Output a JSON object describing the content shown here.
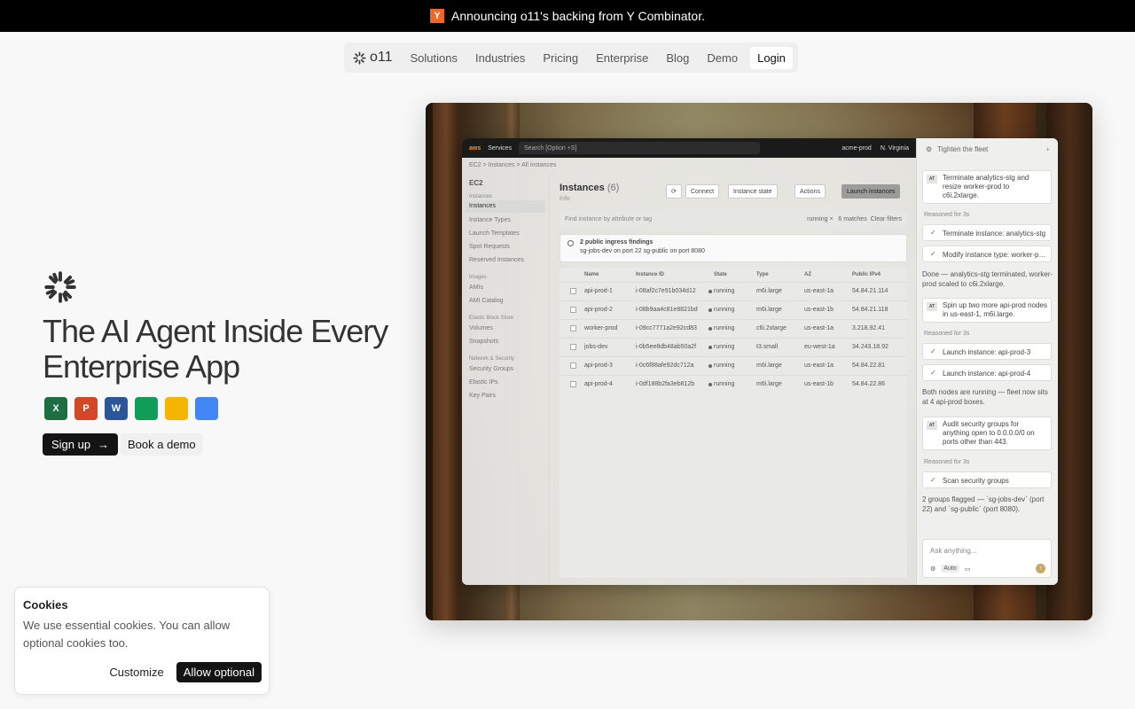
{
  "announcement": {
    "badge": "Y",
    "text": "Announcing o11's backing from Y Combinator."
  },
  "nav": {
    "logo": "o11",
    "links": [
      "Solutions",
      "Industries",
      "Pricing",
      "Enterprise",
      "Blog",
      "Demo"
    ],
    "login": "Login"
  },
  "hero": {
    "title": "The AI Agent Inside Every Enterprise App",
    "apps": [
      {
        "name": "excel-icon",
        "letter": "X",
        "color": "#1d6f42"
      },
      {
        "name": "powerpoint-icon",
        "letter": "P",
        "color": "#d24726"
      },
      {
        "name": "word-icon",
        "letter": "W",
        "color": "#2b579a"
      },
      {
        "name": "google-sheets-icon",
        "letter": "",
        "color": "#0f9d58"
      },
      {
        "name": "google-slides-icon",
        "letter": "",
        "color": "#f4b400"
      },
      {
        "name": "google-docs-icon",
        "letter": "",
        "color": "#4285f4"
      }
    ],
    "signup": "Sign up",
    "signup_arrow": "→",
    "book_demo": "Book a demo"
  },
  "cookies": {
    "title": "Cookies",
    "body": "We use essential cookies. You can allow optional cookies too.",
    "customize": "Customize",
    "allow": "Allow optional"
  },
  "console": {
    "topbar": {
      "logo": "aws",
      "services": "Services",
      "search": "Search [Option +S]",
      "account": "acme-prod",
      "region": "N. Virginia"
    },
    "breadcrumb": "EC2  >  Instances  >  All instances",
    "sidebar": {
      "title": "EC2",
      "sections": [
        {
          "label": "Instances",
          "items": [
            "Instances",
            "Instance Types",
            "Launch Templates",
            "Spot Requests",
            "Reserved Instances"
          ]
        },
        {
          "label": "Images",
          "items": [
            "AMIs",
            "AMI Catalog"
          ]
        },
        {
          "label": "Elastic Block Store",
          "items": [
            "Volumes",
            "Snapshots"
          ]
        },
        {
          "label": "Network & Security",
          "items": [
            "Security Groups",
            "Elastic IPs",
            "Key Pairs"
          ]
        }
      ]
    },
    "main": {
      "title": "Instances",
      "count": "(6)",
      "info": "Info",
      "buttons": {
        "refresh": "⟳",
        "connect": "Connect",
        "state": "Instance state",
        "actions": "Actions",
        "launch": "Launch instances"
      },
      "filter_placeholder": "Find instance by attribute or tag",
      "filter_tag": "running ×",
      "filter_matches": "6 matches",
      "clear": "Clear filters",
      "alert_title": "2 public ingress findings",
      "alert_body": "sg-jobs-dev on port 22    sg-public on port 8080",
      "columns": [
        "Name",
        "Instance ID",
        "State",
        "Type",
        "AZ",
        "Public IPv4"
      ],
      "rows": [
        [
          "api-prod-1",
          "i-08af2c7e91b034d12",
          "running",
          "m6i.large",
          "us-east-1a",
          "54.84.21.114"
        ],
        [
          "api-prod-2",
          "i-08b9aa4c81e8821bd",
          "running",
          "m6i.large",
          "us-east-1b",
          "54.84.21.118"
        ],
        [
          "worker-prod",
          "i-09cc7771a2e92cd83",
          "running",
          "c6i.2xlarge",
          "us-east-1a",
          "3.218.92.41"
        ],
        [
          "jobs-dev",
          "i-0b5ee8db48ab50a2f",
          "running",
          "t3.small",
          "eu-west-1a",
          "34.243.18.92"
        ],
        [
          "api-prod-3",
          "i-0c6f88afe92dc712a",
          "running",
          "m6i.large",
          "us-east-1a",
          "54.84.22.81"
        ],
        [
          "api-prod-4",
          "i-0df188b2fa3eb812b",
          "running",
          "m6i.large",
          "us-east-1b",
          "54.84.22.86"
        ]
      ]
    },
    "chat": {
      "title": "Tighten the fleet",
      "avatar": "AT",
      "user_1": "Terminate analytics-stg and resize worker-prod to c6i.2xlarge.",
      "reasoned": "Reasoned for 3s",
      "tool_1": "Terminate instance: analytics-stg",
      "tool_2": "Modify instance type: worker-prod",
      "reply_1": "Done — analytics-stg terminated, worker-prod scaled to c6i.2xlarge.",
      "user_2": "Spin up two more api-prod nodes in us-east-1, m6i.large.",
      "tool_3": "Launch instance: api-prod-3",
      "tool_4": "Launch instance: api-prod-4",
      "reply_2": "Both nodes are running — fleet now sits at 4 api-prod boxes.",
      "user_3": "Audit security groups for anything open to 0.0.0.0/0 on ports other than 443.",
      "tool_5": "Scan security groups",
      "reply_3": "2 groups flagged — `sg-jobs-dev` (port 22) and `sg-public` (port 8080).",
      "input_placeholder": "Ask anything...",
      "mode": "Auto"
    }
  }
}
